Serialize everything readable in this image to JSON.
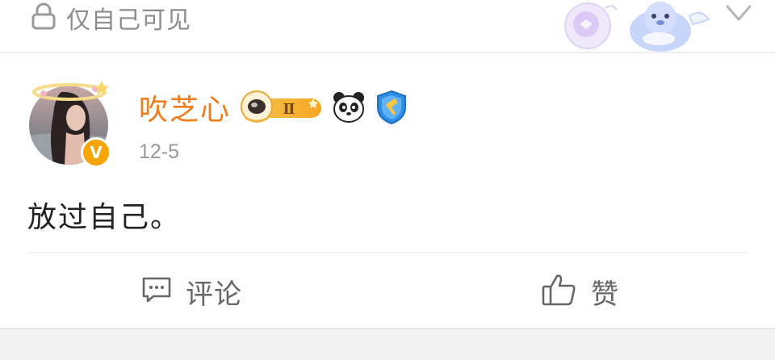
{
  "previous_post": {
    "privacy_label": "仅自己可见",
    "privacy_icon": "lock-icon",
    "expand_icon": "chevron-down-icon"
  },
  "post": {
    "author": {
      "name": "吹芝心",
      "avatar": "avatar",
      "verified_icon": "verified-v-icon",
      "badges": [
        "astronaut-level-badge",
        "panda-badge",
        "shield-hammer-badge"
      ],
      "level_mark": "Ⅱ"
    },
    "timestamp": "12-5",
    "text": "放过自己。"
  },
  "actions": {
    "comment_label": "评论",
    "comment_icon": "comment-icon",
    "like_label": "赞",
    "like_icon": "thumbs-up-icon"
  },
  "colors": {
    "username": "#f07c1a",
    "verified": "#f7a400",
    "muted_text": "#9a9a9a",
    "body_text": "#222222",
    "divider": "#ececec"
  }
}
